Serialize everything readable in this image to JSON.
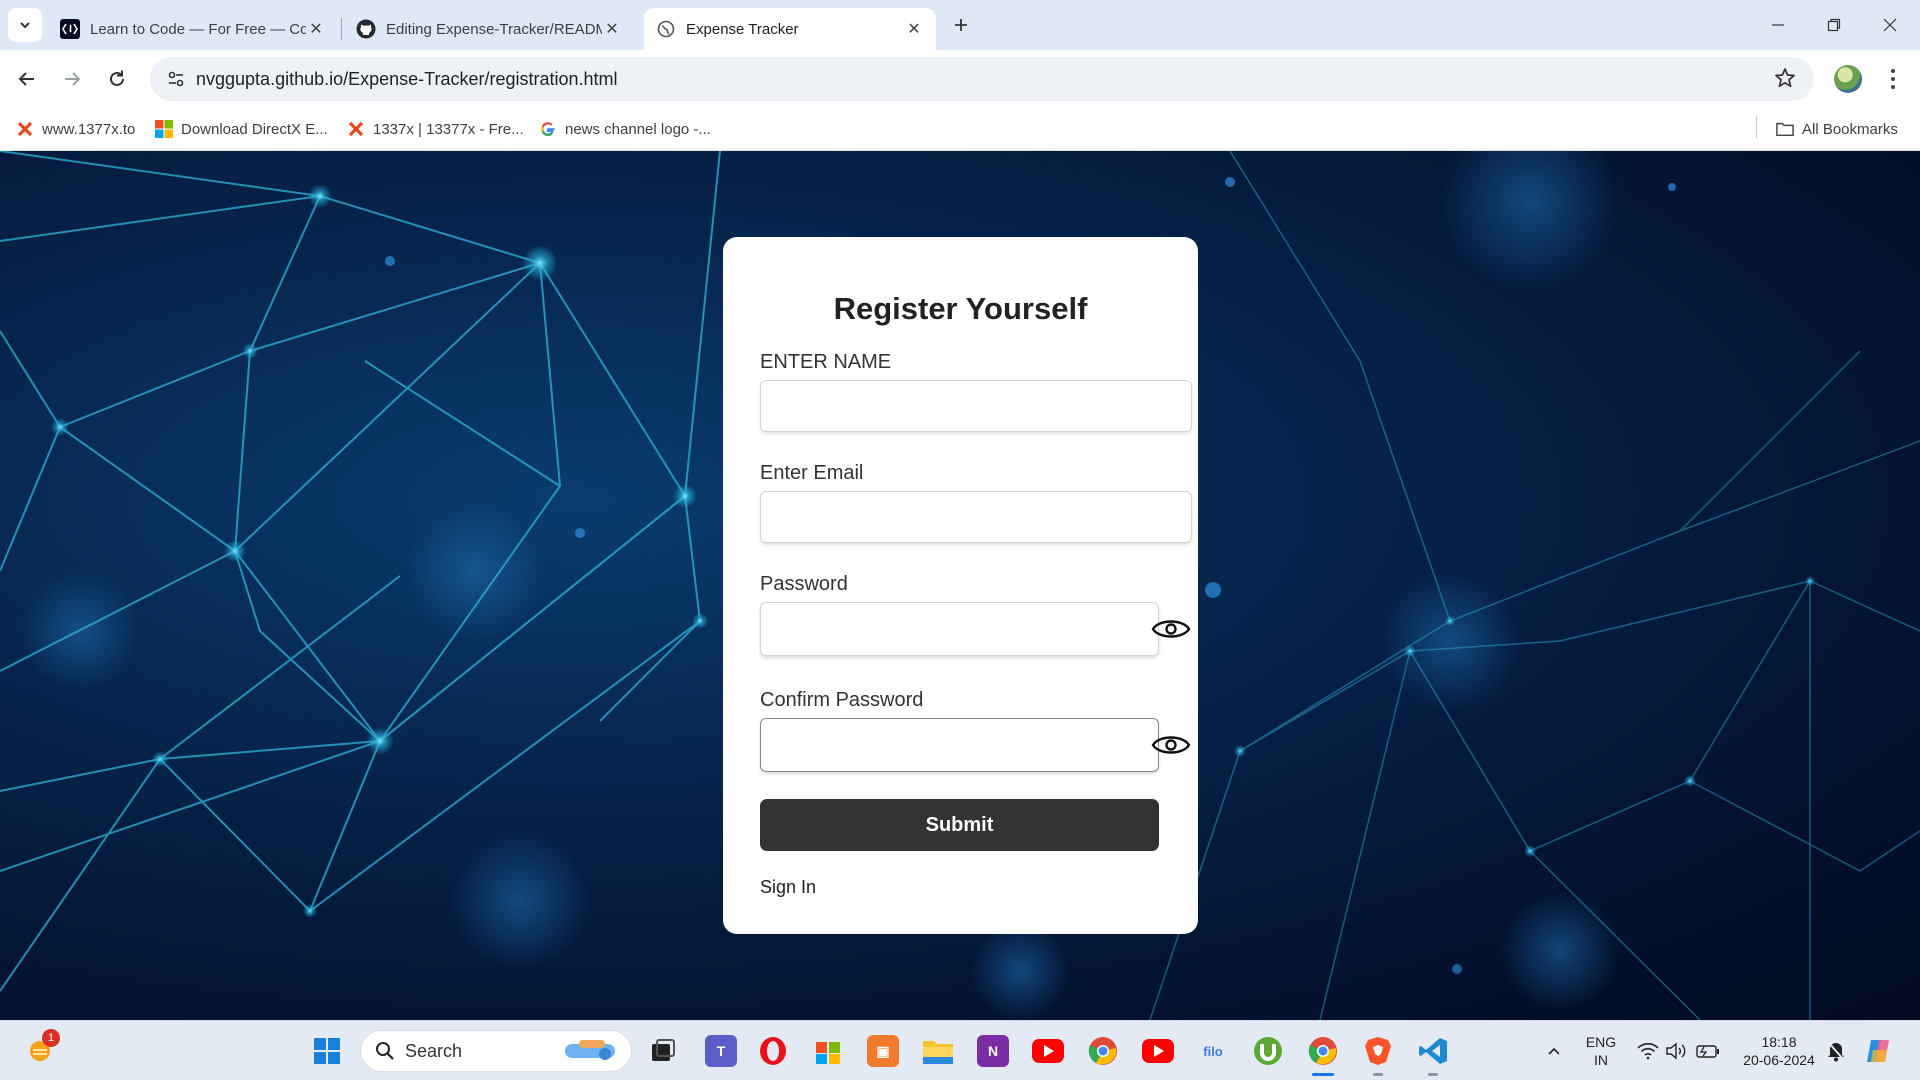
{
  "browser": {
    "tabs": [
      {
        "title": "Learn to Code — For Free — Co",
        "icon": "freecodecamp-icon",
        "active": false
      },
      {
        "title": "Editing Expense-Tracker/READM",
        "icon": "github-icon",
        "active": false
      },
      {
        "title": "Expense Tracker",
        "icon": "globe-icon",
        "active": true
      }
    ],
    "url_host": "nvggupta.github.io",
    "url_path": "/Expense-Tracker/registration.html",
    "bookmarks": [
      {
        "label": "www.1377x.to",
        "icon": "x-icon"
      },
      {
        "label": "Download DirectX E...",
        "icon": "microsoft-icon"
      },
      {
        "label": "1337x | 13377x - Fre...",
        "icon": "x-icon"
      },
      {
        "label": "news channel logo -...",
        "icon": "google-icon"
      }
    ],
    "all_bookmarks": "All Bookmarks"
  },
  "form": {
    "title": "Register Yourself",
    "name_label": "ENTER NAME",
    "email_label": "Enter Email",
    "password_label": "Password",
    "confirm_password_label": "Confirm Password",
    "submit_label": "Submit",
    "signin_label": "Sign In"
  },
  "taskbar": {
    "search_placeholder": "Search",
    "weather_badge": "1",
    "language_line1": "ENG",
    "language_line2": "IN",
    "time": "18:18",
    "date": "20-06-2024",
    "filo_label": "filo"
  },
  "colors": {
    "tabstrip": "#dfe8f7",
    "submit_bg": "#333333",
    "page_bg": "#06234a",
    "network_lines": "#2fb4d8"
  }
}
